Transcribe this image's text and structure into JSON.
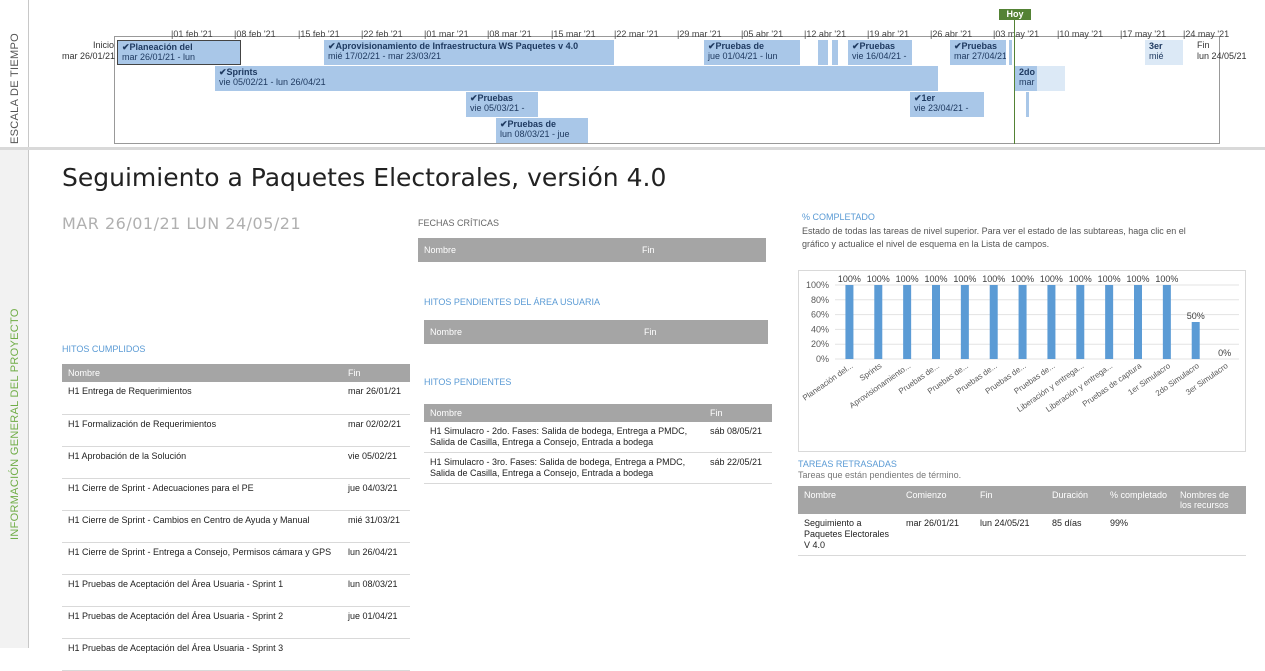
{
  "side": {
    "timeline_label": "ESCALA DE TIEMPO",
    "overview_label": "INFORMACIÓN GENERAL DEL PROYECTO"
  },
  "timeline": {
    "today_label": "Hoy",
    "start_label": "Inicio",
    "start_date": "mar 26/01/21",
    "end_label": "Fin",
    "end_date": "lun 24/05/21",
    "ticks": [
      "01 feb '21",
      "08 feb '21",
      "15 feb '21",
      "22 feb '21",
      "01 mar '21",
      "08 mar '21",
      "15 mar '21",
      "22 mar '21",
      "29 mar '21",
      "05 abr '21",
      "12 abr '21",
      "19 abr '21",
      "26 abr '21",
      "03 may '21",
      "10 may '21",
      "17 may '21",
      "24 may '21"
    ],
    "bars": [
      {
        "title": "✔Planeación del",
        "sub": "mar 26/01/21 - lun"
      },
      {
        "title": "✔Aprovisionamiento de Infraestructura WS Paquetes v 4.0",
        "sub": "mié 17/02/21 - mar 23/03/21"
      },
      {
        "title": "✔Pruebas de",
        "sub": "jue 01/04/21 - lun"
      },
      {
        "title": "✔Pruebas",
        "sub": "vie 16/04/21 -"
      },
      {
        "title": "✔Pruebas",
        "sub": "mar 27/04/21"
      },
      {
        "title": "3er",
        "sub": "mié"
      },
      {
        "title": "✔Sprints",
        "sub": "vie 05/02/21 - lun 26/04/21"
      },
      {
        "title": "2do",
        "sub": "mar"
      },
      {
        "title": "✔Pruebas",
        "sub": "vie 05/03/21 -"
      },
      {
        "title": "✔1er",
        "sub": "vie 23/04/21 -"
      },
      {
        "title": "✔Pruebas de",
        "sub": "lun 08/03/21 - jue"
      }
    ]
  },
  "report": {
    "title": "Seguimiento a Paquetes Electorales, versión 4.0",
    "date_range": "MAR 26/01/21   LUN 24/05/21"
  },
  "criticas": {
    "title": "FECHAS CRÍTICAS",
    "headers": [
      "Nombre",
      "Fin"
    ]
  },
  "pendientes_usuaria": {
    "title": "HITOS PENDIENTES DEL ÁREA USUARIA",
    "headers": [
      "Nombre",
      "Fin"
    ]
  },
  "cumplidos": {
    "title": "HITOS CUMPLIDOS",
    "headers": [
      "Nombre",
      "Fin"
    ],
    "rows": [
      {
        "name": "H1 Entrega de Requerimientos",
        "end": "mar 26/01/21"
      },
      {
        "name": "H1 Formalización de Requerimientos",
        "end": "mar 02/02/21"
      },
      {
        "name": "H1 Aprobación de la Solución",
        "end": "vie 05/02/21"
      },
      {
        "name": "H1 Cierre de Sprint - Adecuaciones para el PE",
        "end": "jue 04/03/21"
      },
      {
        "name": "H1 Cierre de Sprint - Cambios en Centro de Ayuda y Manual",
        "end": "mié 31/03/21"
      },
      {
        "name": "H1 Cierre de Sprint - Entrega a Consejo, Permisos cámara y GPS",
        "end": "lun 26/04/21"
      },
      {
        "name": "H1 Pruebas de Aceptación del Área Usuaria - Sprint 1",
        "end": "lun 08/03/21"
      },
      {
        "name": "H1 Pruebas de Aceptación del Área Usuaria - Sprint 2",
        "end": "jue 01/04/21"
      },
      {
        "name": "H1 Pruebas de Aceptación del Área Usuaria - Sprint 3",
        "end": ""
      }
    ]
  },
  "pendientes": {
    "title": "HITOS PENDIENTES",
    "headers": [
      "Nombre",
      "Fin"
    ],
    "rows": [
      {
        "name": "H1 Simulacro - 2do. Fases: Salida de bodega, Entrega a PMDC, Salida de Casilla, Entrega a Consejo, Entrada a bodega",
        "end": "sáb 08/05/21"
      },
      {
        "name": "H1 Simulacro - 3ro. Fases: Salida de bodega, Entrega a PMDC, Salida de Casilla, Entrega a Consejo, Entrada a bodega",
        "end": "sáb 22/05/21"
      }
    ]
  },
  "completado": {
    "title": "% COMPLETADO",
    "description": "Estado de todas las tareas de nivel superior. Para ver el estado de las subtareas, haga clic en el gráfico y actualice el nivel de esquema en la Lista de campos."
  },
  "chart_data": {
    "type": "bar",
    "categories": [
      "Planeación del...",
      "Sprints",
      "Aprovisionamiento...",
      "Pruebas de...",
      "Pruebas de...",
      "Pruebas de...",
      "Pruebas de...",
      "Pruebas de...",
      "Liberación y entrega...",
      "Liberación y entrega...",
      "Pruebas de captura",
      "1er Simulacro",
      "2do Simulacro",
      "3er Simulacro"
    ],
    "values": [
      100,
      100,
      100,
      100,
      100,
      100,
      100,
      100,
      100,
      100,
      100,
      100,
      50,
      0
    ],
    "value_labels": [
      "100%",
      "100%",
      "100%",
      "100%",
      "100%",
      "100%",
      "100%",
      "100%",
      "100%",
      "100%",
      "100%",
      "100%",
      "50%",
      "0%"
    ],
    "yticks": [
      "0%",
      "20%",
      "40%",
      "60%",
      "80%",
      "100%"
    ],
    "ylim": [
      0,
      100
    ],
    "bar_color": "#5b9bd5"
  },
  "retrasadas": {
    "title": "TAREAS RETRASADAS",
    "subtitle": "Tareas que están pendientes de término.",
    "headers": [
      "Nombre",
      "Comienzo",
      "Fin",
      "Duración",
      "% completado",
      "Nombres de los recursos"
    ],
    "rows": [
      {
        "name": "Seguimiento a Paquetes Electorales V 4.0",
        "start": "mar 26/01/21",
        "end": "lun 24/05/21",
        "duration": "85 días",
        "pct": "99%",
        "resources": ""
      }
    ]
  }
}
